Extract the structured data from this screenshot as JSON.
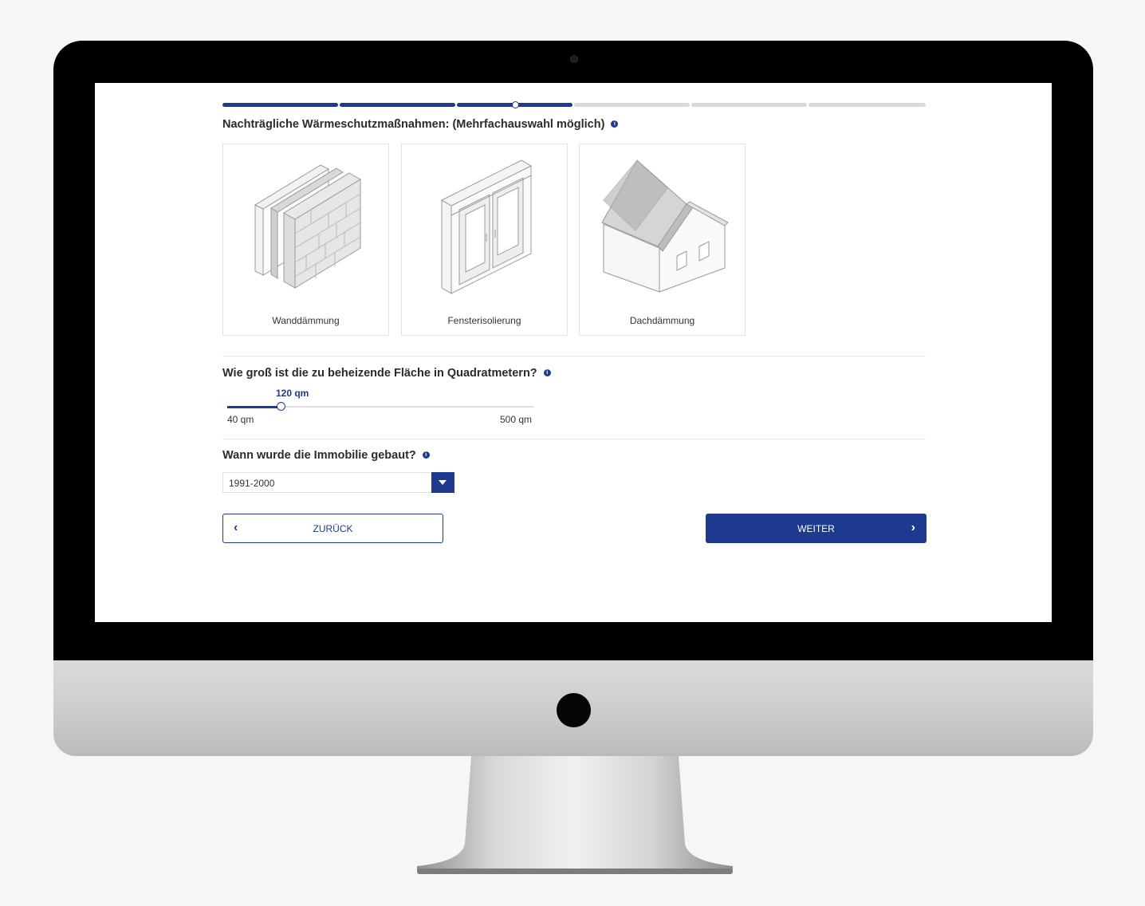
{
  "progress": {
    "total_steps": 6,
    "completed_steps": 3
  },
  "section_measures": {
    "title": "Nachträgliche Wärmeschutzmaßnahmen: (Mehrfachauswahl möglich)",
    "info_icon": "info-icon",
    "options": [
      {
        "label": "Wanddämmung",
        "icon": "wall-insulation-icon"
      },
      {
        "label": "Fensterisolierung",
        "icon": "window-insulation-icon"
      },
      {
        "label": "Dachdämmung",
        "icon": "roof-insulation-icon"
      }
    ]
  },
  "section_area": {
    "title": "Wie groß ist die zu beheizende Fläche in Quadratmetern?",
    "value_label": "120 qm",
    "value": 120,
    "min": 40,
    "max": 500,
    "min_label": "40 qm",
    "max_label": "500 qm"
  },
  "section_year": {
    "title": "Wann wurde die Immobilie gebaut?",
    "selected": "1991-2000"
  },
  "buttons": {
    "back": "ZURÜCK",
    "next": "WEITER"
  },
  "colors": {
    "accent": "#1e3a8e",
    "inactive": "#d9d9d9",
    "bezel": "#000000"
  }
}
